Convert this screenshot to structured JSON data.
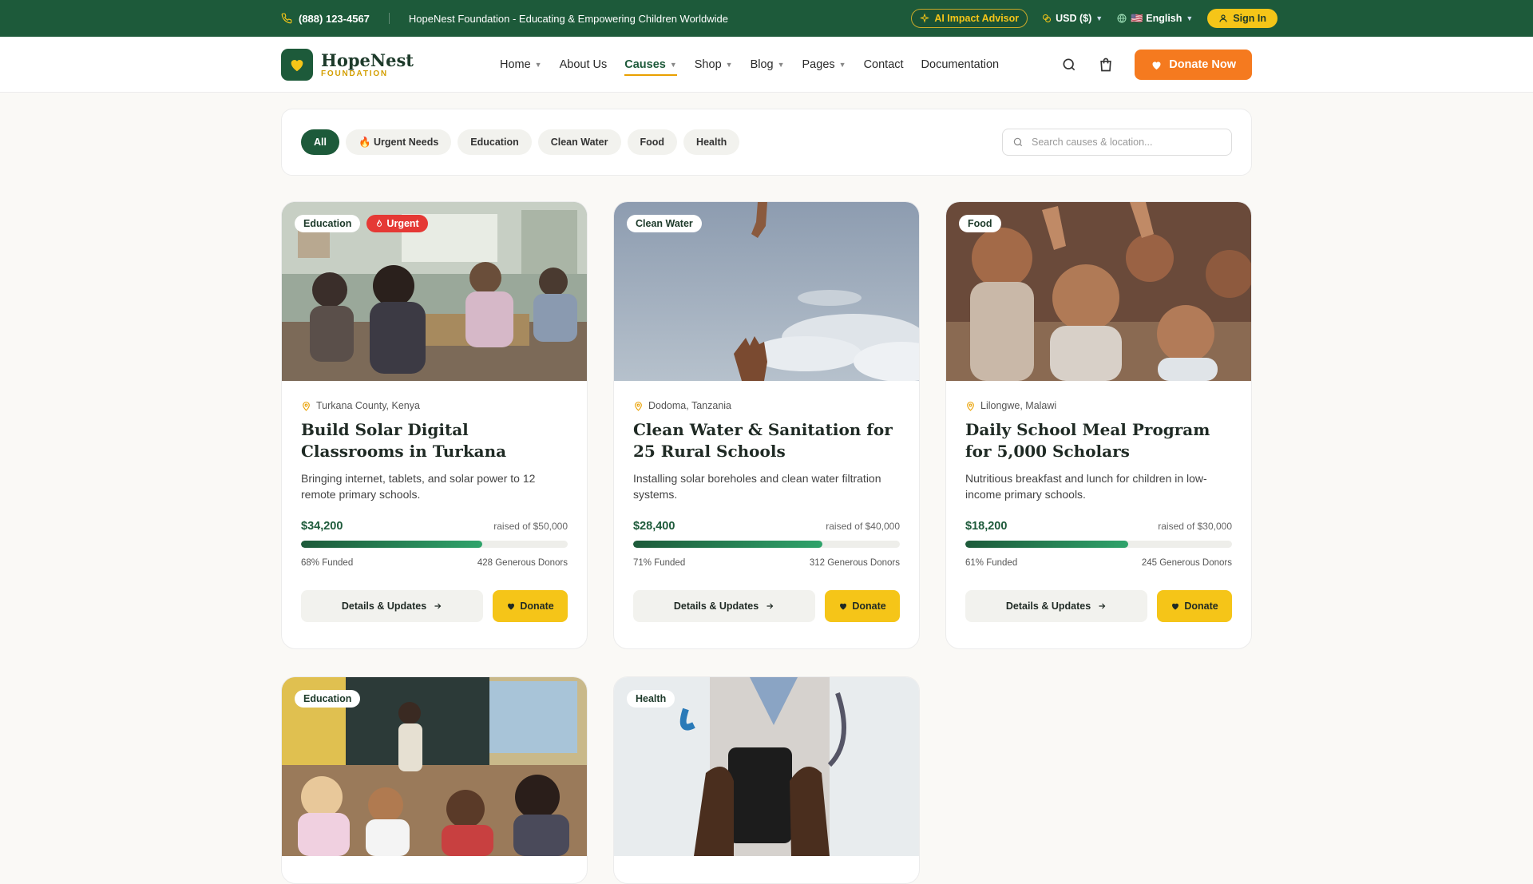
{
  "topbar": {
    "phone": "(888) 123-4567",
    "tagline": "HopeNest Foundation - Educating & Empowering Children Worldwide",
    "ai_advisor": "AI Impact Advisor",
    "currency": "USD ($)",
    "language": "🇺🇸 English",
    "sign_in": "Sign In"
  },
  "header": {
    "brand": "HopeNest",
    "brand_sub": "FOUNDATION",
    "nav": [
      {
        "label": "Home"
      },
      {
        "label": "About Us"
      },
      {
        "label": "Causes"
      },
      {
        "label": "Shop"
      },
      {
        "label": "Blog"
      },
      {
        "label": "Pages"
      },
      {
        "label": "Contact"
      },
      {
        "label": "Documentation"
      }
    ],
    "donate_now": "Donate Now"
  },
  "filters": {
    "chips": [
      "All",
      "🔥 Urgent Needs",
      "Education",
      "Clean Water",
      "Food",
      "Health"
    ],
    "search_placeholder": "Search causes & location..."
  },
  "causes": [
    {
      "category": "Education",
      "urgent_label": "Urgent",
      "location": "Turkana County, Kenya",
      "title": "Build Solar Digital Classrooms in Turkana",
      "description": "Bringing internet, tablets, and solar power to 12 remote primary schools.",
      "raised": "$34,200",
      "goal": "raised of $50,000",
      "funded_pct": 68,
      "funded_label": "68% Funded",
      "donors": "428 Generous Donors",
      "details_label": "Details & Updates",
      "donate_label": "Donate"
    },
    {
      "category": "Clean Water",
      "location": "Dodoma, Tanzania",
      "title": "Clean Water & Sanitation for 25 Rural Schools",
      "description": "Installing solar boreholes and clean water filtration systems.",
      "raised": "$28,400",
      "goal": "raised of $40,000",
      "funded_pct": 71,
      "funded_label": "71% Funded",
      "donors": "312 Generous Donors",
      "details_label": "Details & Updates",
      "donate_label": "Donate"
    },
    {
      "category": "Food",
      "location": "Lilongwe, Malawi",
      "title": "Daily School Meal Program for 5,000 Scholars",
      "description": "Nutritious breakfast and lunch for children in low-income primary schools.",
      "raised": "$18,200",
      "goal": "raised of $30,000",
      "funded_pct": 61,
      "funded_label": "61% Funded",
      "donors": "245 Generous Donors",
      "details_label": "Details & Updates",
      "donate_label": "Donate"
    },
    {
      "category": "Education"
    },
    {
      "category": "Health"
    }
  ],
  "colors": {
    "brand_green": "#1d5a3a",
    "accent_orange": "#f57a1f",
    "accent_yellow": "#f5c518",
    "urgent_red": "#e53935"
  }
}
